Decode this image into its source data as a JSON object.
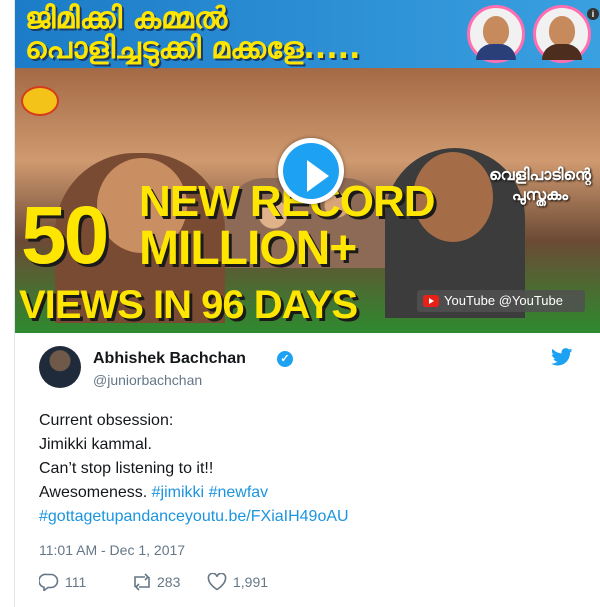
{
  "media": {
    "title": "ജിമിക്കി കമ്മൽ\nപൊളിച്ചടുക്കി മക്കളേ.....",
    "headline_number": "50",
    "headline_record": "NEW RECORD",
    "headline_million": "MILLION+",
    "headline_views": "VIEWS IN 96 DAYS",
    "film_title": "വെളിപാടിന്റെ പുസ്തകം",
    "info_label": "i",
    "yt_attribution": "YouTube @YouTube"
  },
  "tweet": {
    "author_name": "Abhishek Bachchan",
    "verified_mark": "✓",
    "handle": "@juniorbachchan",
    "lines": [
      "Current obsession:",
      "Jimikki kammal.",
      "Can’t stop listening to it!!"
    ],
    "line4_prefix": "Awesomeness. ",
    "hashtag1": "#jimikki",
    "hashtag2": "#newfav",
    "line5": "#gottagetupandanceyoutu.be/FXiaIH49oAU",
    "timestamp": "11:01 AM - Dec 1, 2017",
    "reply_count": "111",
    "retweet_count": "283",
    "like_count": "1,991"
  },
  "colors": {
    "accent": "#1da1f2",
    "link": "#1b95e0",
    "text": "#14171a",
    "muted": "#657786",
    "headline_yellow": "#ffe600"
  },
  "icons": [
    "play-icon",
    "info-icon",
    "youtube-icon",
    "verified-icon",
    "twitter-bird-icon",
    "reply-icon",
    "retweet-icon",
    "like-icon"
  ]
}
